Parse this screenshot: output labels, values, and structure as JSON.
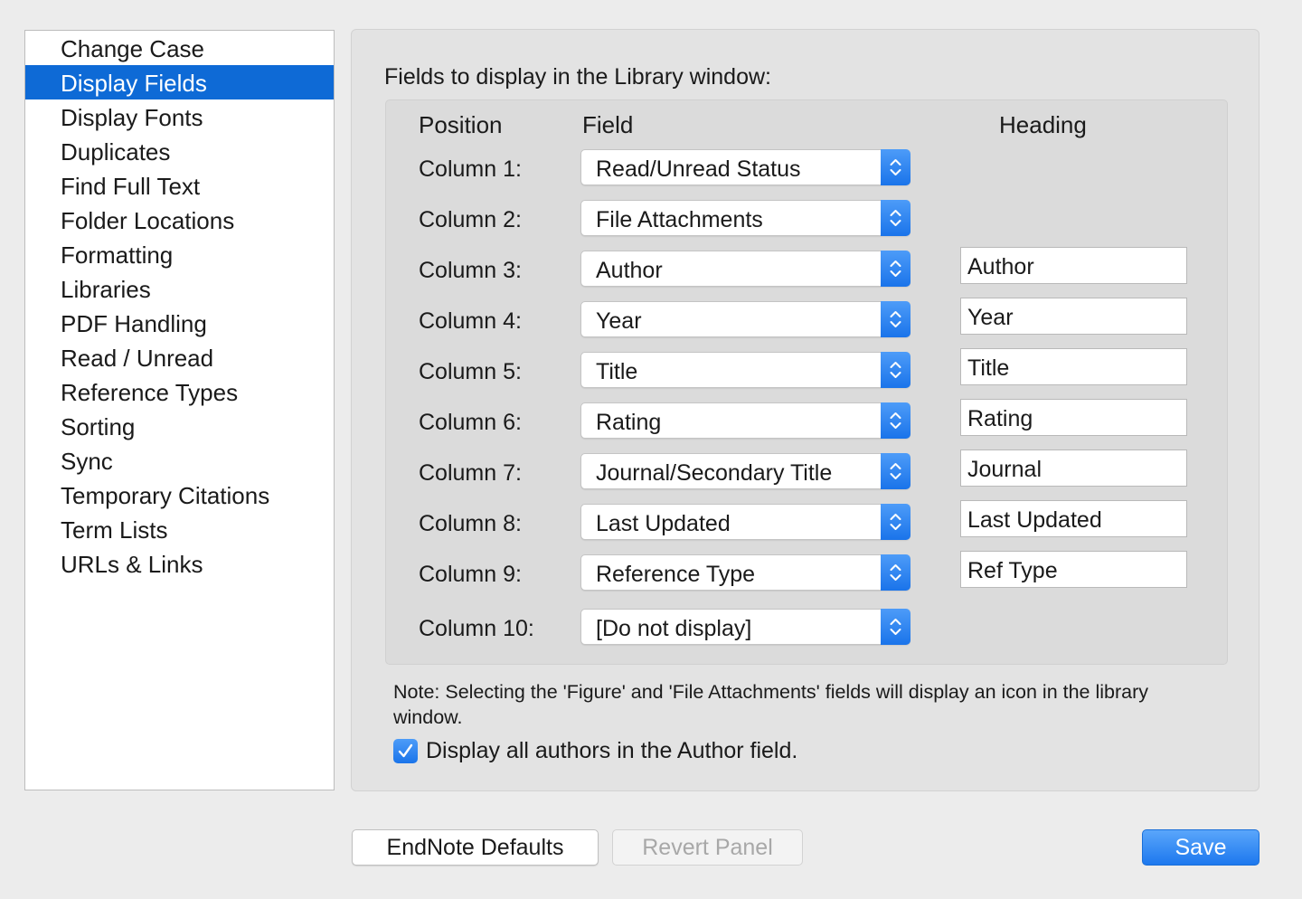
{
  "sidebar": {
    "items": [
      {
        "label": "Change Case",
        "selected": false
      },
      {
        "label": "Display Fields",
        "selected": true
      },
      {
        "label": "Display Fonts",
        "selected": false
      },
      {
        "label": "Duplicates",
        "selected": false
      },
      {
        "label": "Find Full Text",
        "selected": false
      },
      {
        "label": "Folder Locations",
        "selected": false
      },
      {
        "label": "Formatting",
        "selected": false
      },
      {
        "label": "Libraries",
        "selected": false
      },
      {
        "label": "PDF Handling",
        "selected": false
      },
      {
        "label": "Read / Unread",
        "selected": false
      },
      {
        "label": "Reference Types",
        "selected": false
      },
      {
        "label": "Sorting",
        "selected": false
      },
      {
        "label": "Sync",
        "selected": false
      },
      {
        "label": "Temporary Citations",
        "selected": false
      },
      {
        "label": "Term Lists",
        "selected": false
      },
      {
        "label": "URLs & Links",
        "selected": false
      }
    ]
  },
  "panel": {
    "title": "Fields to display in the Library window:",
    "headers": {
      "position": "Position",
      "field": "Field",
      "heading": "Heading"
    },
    "columns": [
      {
        "label": "Column 1:",
        "field": "Read/Unread Status",
        "heading": null
      },
      {
        "label": "Column 2:",
        "field": "File Attachments",
        "heading": null
      },
      {
        "label": "Column 3:",
        "field": "Author",
        "heading": "Author"
      },
      {
        "label": "Column 4:",
        "field": "Year",
        "heading": "Year"
      },
      {
        "label": "Column 5:",
        "field": "Title",
        "heading": "Title"
      },
      {
        "label": "Column 6:",
        "field": "Rating",
        "heading": "Rating"
      },
      {
        "label": "Column 7:",
        "field": "Journal/Secondary Title",
        "heading": "Journal"
      },
      {
        "label": "Column 8:",
        "field": "Last Updated",
        "heading": "Last Updated"
      },
      {
        "label": "Column 9:",
        "field": "Reference Type",
        "heading": "Ref Type"
      },
      {
        "label": "Column 10:",
        "field": "[Do not display]",
        "heading": null
      }
    ],
    "note": "Note:  Selecting the 'Figure' and 'File Attachments' fields will display an icon in the library window.",
    "checkbox": {
      "label": "Display all authors in the Author field.",
      "checked": true
    }
  },
  "buttons": {
    "defaults": "EndNote Defaults",
    "revert": "Revert Panel",
    "save": "Save"
  },
  "colors": {
    "accent": "#0e6ad6",
    "stepper": "#1a74ea",
    "disabled_text": "#a8a8a8"
  }
}
